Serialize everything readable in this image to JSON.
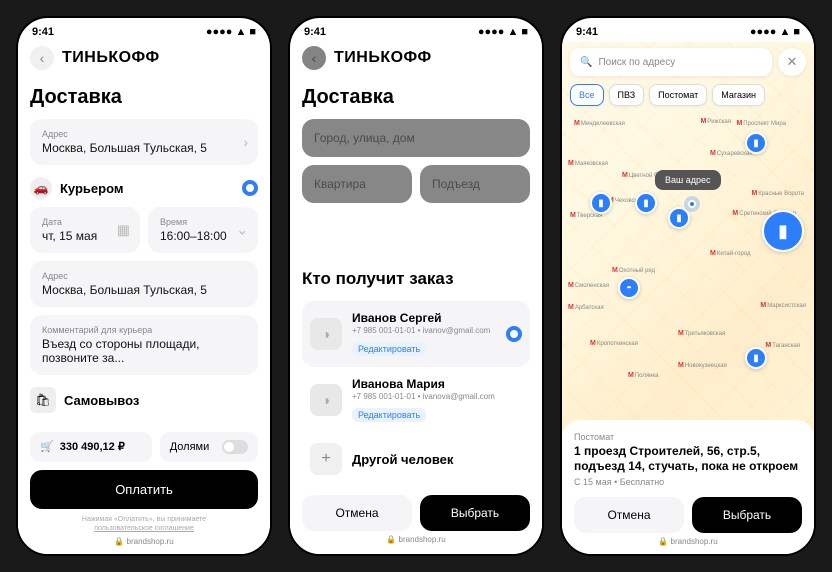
{
  "status": {
    "time": "9:41"
  },
  "brand": "ТИНЬКОФФ",
  "url": "brandshop.ru",
  "s1": {
    "title": "Доставка",
    "addr_lbl": "Адрес",
    "addr": "Москва, Большая Тульская, 5",
    "method": "Курьером",
    "date_lbl": "Дата",
    "date": "чт, 15 мая",
    "time_lbl": "Время",
    "time": "16:00–18:00",
    "addr2_lbl": "Адрес",
    "addr2": "Москва, Большая Тульская, 5",
    "comment_lbl": "Комментарий для курьера",
    "comment": "Въезд со стороны площади, позвоните за...",
    "pickup": "Самовывоз",
    "price": "330 490,12 ₽",
    "split": "Долями",
    "pay": "Оплатить",
    "disc1": "Нажимая «Оплатить», вы принимаете",
    "disc2": "пользовательское соглашение"
  },
  "s2": {
    "title": "Доставка",
    "ph_addr": "Город, улица, дом",
    "ph_flat": "Квартира",
    "ph_ent": "Подъезд",
    "sheet_title": "Кто получит заказ",
    "p": [
      {
        "name": "Иванов Сергей",
        "det": "+7 985 001-01-01 • ivanov@gmail.com",
        "edit": "Редактировать",
        "sel": true
      },
      {
        "name": "Иванова Мария",
        "det": "+7 985 001-01-01 • ivanova@gmail.com",
        "edit": "Редактировать",
        "sel": false
      }
    ],
    "other": "Другой человек",
    "cancel": "Отмена",
    "choose": "Выбрать"
  },
  "s3": {
    "search_ph": "Поиск по адресу",
    "filters": [
      "Все",
      "ПВЗ",
      "Постомат",
      "Магазин"
    ],
    "you": "Ваш адрес",
    "metros": [
      "Менделеевская",
      "Проспект Мира",
      "Сухаревская",
      "Цветной бульвар",
      "Чеховская",
      "Тверская",
      "Китай-город",
      "Охотный ряд",
      "Арбатская",
      "Третьяковская",
      "Кропоткинская",
      "Новокузнецкая",
      "Марксистская",
      "Полянка",
      "Таганская",
      "Рижская",
      "Красные Ворота",
      "Сретенский бульвар",
      "Маяковская",
      "Смоленская"
    ],
    "type": "Постомат",
    "addr": "1 проезд Строителей, 56, стр.5, подъезд 14, стучать, пока не откроем",
    "meta": "С 15 мая • Бесплатно",
    "cancel": "Отмена",
    "choose": "Выбрать"
  }
}
